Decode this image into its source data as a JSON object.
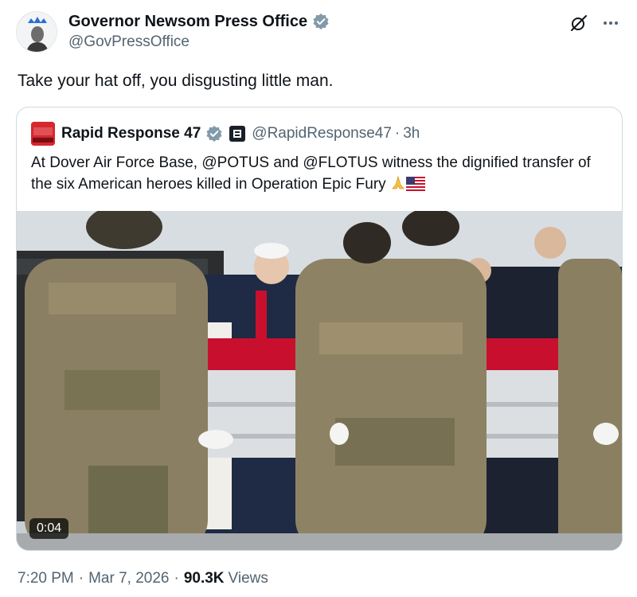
{
  "author": {
    "name": "Governor Newsom Press Office",
    "handle": "@GovPressOffice"
  },
  "tweet": {
    "text": "Take your hat off, you disgusting little man."
  },
  "quoted": {
    "name": "Rapid Response 47",
    "handle": "@RapidResponse47",
    "separator": "·",
    "time": "3h",
    "text": "At Dover Air Force Base, @POTUS and @FLOTUS witness the dignified transfer of the six American heroes killed in Operation Epic Fury",
    "media": {
      "type": "video",
      "duration": "0:04"
    },
    "avatar_logo_text": "RAPID RESPONSE"
  },
  "meta": {
    "time": "7:20 PM",
    "date": "Mar 7, 2026",
    "separator": "·",
    "views_count": "90.3K",
    "views_label": "Views"
  },
  "icons": {
    "verified": "verified-badge-icon",
    "grok": "grok-icon",
    "more": "more-icon",
    "affiliate": "affiliate-badge-icon",
    "praying_hands": "praying-hands-emoji",
    "us_flag": "us-flag-emoji"
  },
  "colors": {
    "verified": "#829aab",
    "text_primary": "#0f1419",
    "text_secondary": "#536471",
    "border": "#cfd9de"
  }
}
